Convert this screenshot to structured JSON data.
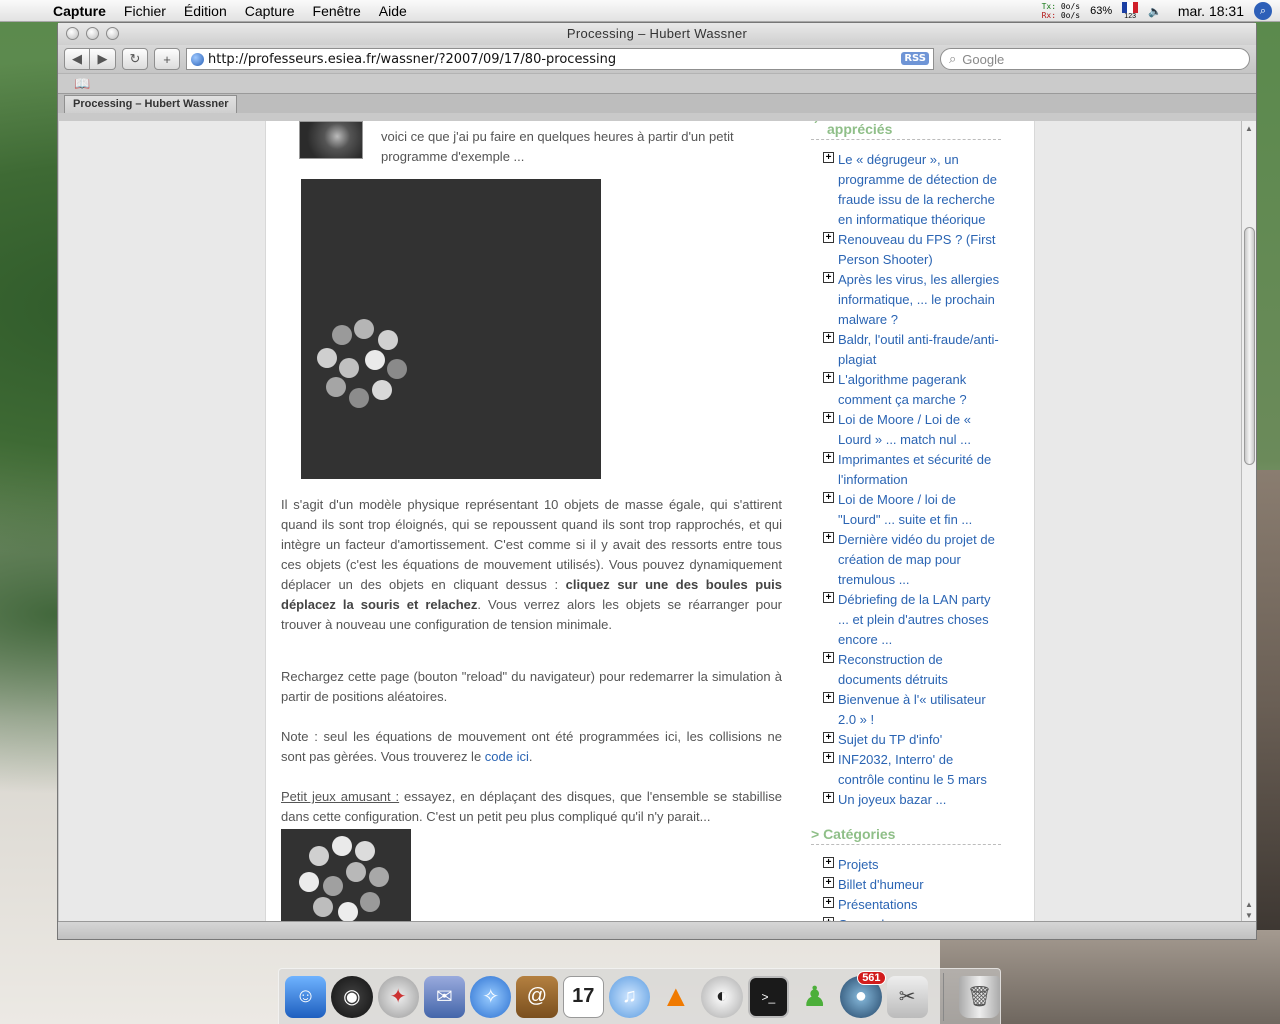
{
  "menubar": {
    "app_name": "Capture",
    "menus": [
      "Fichier",
      "Édition",
      "Capture",
      "Fenêtre",
      "Aide"
    ],
    "net_tx_label": "Tx:",
    "net_tx_value": "0o/s",
    "net_rx_label": "Rx:",
    "net_rx_value": "0o/s",
    "battery": "63%",
    "input_source": "123",
    "clock": "mar. 18:31"
  },
  "browser": {
    "window_title": "Processing – Hubert Wassner",
    "url": "http://professeurs.esiea.fr/wassner/?2007/09/17/80-processing",
    "rss_label": "RSS",
    "search_placeholder": "Google",
    "tab_label": "Processing – Hubert Wassner"
  },
  "article": {
    "excerpt": "voici ce que j'ai pu faire en quelques heures à partir d'un petit programme d'exemple ...",
    "para1_start": "Il s'agit d'un modèle physique représentant 10 objets de masse égale, qui s'attirent quand ils sont trop éloignés, qui se repoussent quand ils sont trop rapprochés, et qui intègre un facteur d'amortissement. C'est comme si il y avait des ressorts entre tous ces objets (c'est les équations de mouvement utilisés). Vous pouvez dynamiquement déplacer un des objets en cliquant dessus : ",
    "para1_bold": "cliquez sur une des boules puis déplacez la souris et relachez",
    "para1_end": ". Vous verrez alors les objets se réarranger pour trouver à nouveau une configuration de tension minimale.",
    "para2": "Rechargez cette page (bouton \"reload\" du navigateur) pour redemarrer la simulation à partir de positions aléatoires.",
    "para3_start": "Note : seul les équations de mouvement ont été programmées ici, les collisions ne sont pas gèrées. Vous trouverez le ",
    "para3_link": "code ici",
    "para3_end": ".",
    "para4_underline": "Petit jeux amusant :",
    "para4_text": " essayez, en déplaçant des disques, que l'ensemble se stabillise dans cette configuration. C'est un petit peu plus compliqué qu'il n'y parait..."
  },
  "sidebar": {
    "heading_partial": "appréciés",
    "popular": [
      "Le « dégrugeur », un programme de détection de fraude issu de la recherche en informatique théorique",
      "Renouveau du FPS ? (First Person Shooter)",
      "Après les virus, les allergies informatique, ... le prochain malware ?",
      "Baldr, l'outil anti-fraude/anti-plagiat",
      "L'algorithme pagerank comment ça marche ?",
      "Loi de Moore / Loi de « Lourd » ... match nul ...",
      "Imprimantes et sécurité de l'information",
      "Loi de Moore / loi de \"Lourd\" ... suite et fin ...",
      "Dernière vidéo du projet de création de map pour tremulous ...",
      "Débriefing de la LAN party ... et plein d'autres choses encore ...",
      "Reconstruction de documents détruits",
      "Bienvenue à l'« utilisateur 2.0 » !",
      "Sujet du TP d'info'",
      "INF2032, Interro' de contrôle continu le 5 mars",
      "Un joyeux bazar ..."
    ],
    "categories_heading": "> Catégories",
    "categories": [
      "Projets",
      "Billet d'humeur",
      "Présentations",
      "General"
    ]
  },
  "dock": {
    "mail_badge": "561",
    "calendar_day": "17",
    "apps": [
      "Finder",
      "Dashboard",
      "Compass",
      "Mail",
      "Safari",
      "Address Book",
      "iCal",
      "iTunes",
      "VLC",
      "Cyberduck",
      "Terminal",
      "Adium",
      "Ecto",
      "Grab",
      "Trash"
    ]
  },
  "colors": {
    "link": "#2a64b3",
    "sidebar_heading": "#8fbf88",
    "applet_bg": "#323232"
  }
}
